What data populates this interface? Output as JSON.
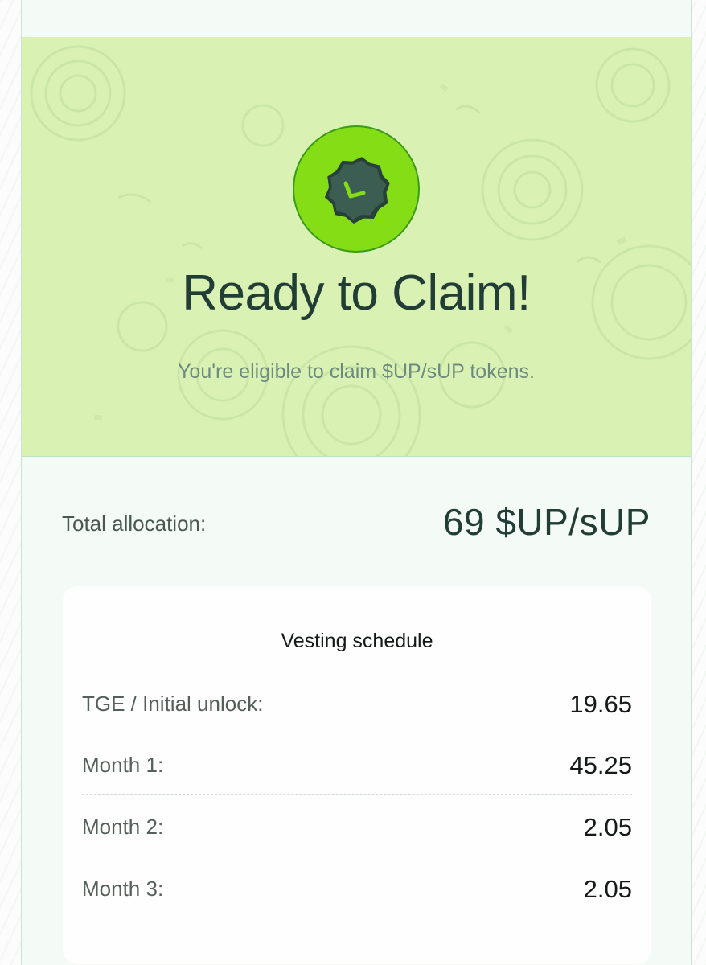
{
  "hero": {
    "title": "Ready to Claim!",
    "subtitle": "You're eligible to claim $UP/sUP tokens.",
    "badge_icon": "clock-badge-icon",
    "background_color": "#d9f2b4",
    "badge_color": "#84dd15"
  },
  "allocation": {
    "label": "Total allocation:",
    "value": "69 $UP/sUP"
  },
  "vesting": {
    "heading": "Vesting schedule",
    "rows": [
      {
        "label": "TGE / Initial unlock:",
        "value": "19.65"
      },
      {
        "label": "Month 1:",
        "value": "45.25"
      },
      {
        "label": "Month 2:",
        "value": "2.05"
      },
      {
        "label": "Month 3:",
        "value": "2.05"
      }
    ]
  },
  "colors": {
    "text_dark": "#213d36",
    "text_muted": "#6e8a7e",
    "card_bg": "#f4faf5",
    "border": "#b9e3c2"
  }
}
